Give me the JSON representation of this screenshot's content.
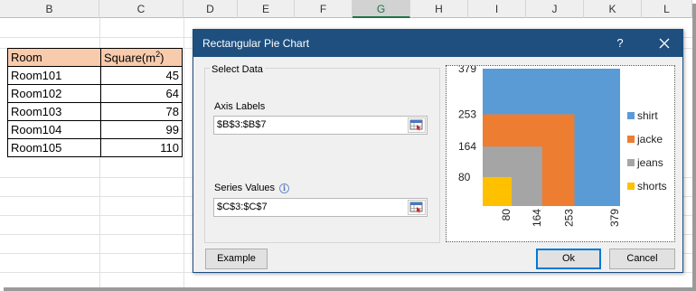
{
  "spreadsheet": {
    "columns": [
      "B",
      "C",
      "D",
      "E",
      "F",
      "G",
      "H",
      "I",
      "J",
      "K",
      "L"
    ],
    "selected_column": "G",
    "headers": {
      "room": "Room",
      "square": "Square(m",
      "square_sup": "2",
      "square_close": ")"
    },
    "rows": [
      {
        "room": "Room101",
        "value": "45"
      },
      {
        "room": "Room102",
        "value": "64"
      },
      {
        "room": "Room103",
        "value": "78"
      },
      {
        "room": "Room104",
        "value": "99"
      },
      {
        "room": "Room105",
        "value": "110"
      }
    ],
    "header_color": "#f8cbad"
  },
  "dialog": {
    "title": "Rectangular Pie Chart",
    "help_label": "?",
    "select_data_label": "Select Data",
    "axis_labels": {
      "label": "Axis Labels",
      "value": "$B$3:$B$7"
    },
    "series_values": {
      "label": "Series Values",
      "value": "$C$3:$C$7"
    },
    "buttons": {
      "example": "Example",
      "ok": "Ok",
      "cancel": "Cancel"
    },
    "titlebar_color": "#1e4f7f"
  },
  "chart_data": {
    "type": "rectangular-pie",
    "categories": [
      "shirt",
      "jacke",
      "jeans",
      "shorts"
    ],
    "values": [
      379,
      253,
      164,
      80
    ],
    "colors": [
      "#5b9bd5",
      "#ed7d31",
      "#a5a5a5",
      "#ffc000"
    ],
    "y_ticks": [
      "379",
      "253",
      "164",
      "80"
    ],
    "x_ticks": [
      "80",
      "164",
      "253",
      "379"
    ],
    "max": 379,
    "legend_position": "right"
  }
}
